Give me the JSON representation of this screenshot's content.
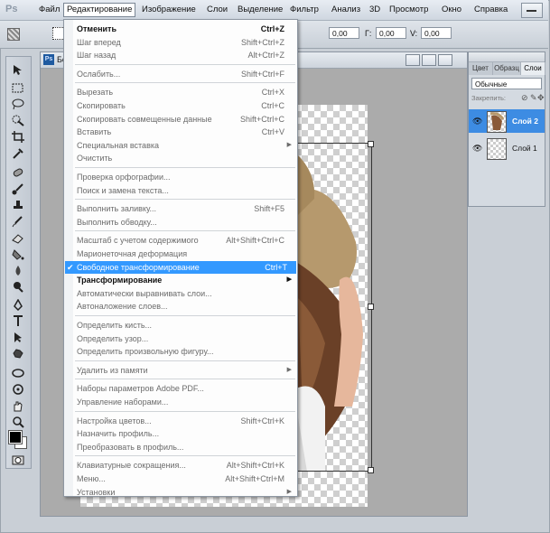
{
  "menubar": {
    "logo": "Ps",
    "items": [
      "Файл",
      "Редактирование",
      "Изображение",
      "Слои",
      "Выделение",
      "Фильтр",
      "Анализ",
      "3D",
      "Просмотр",
      "Окно",
      "Справка"
    ]
  },
  "options": {
    "f1_value": "0,00",
    "f2_label": "Г:",
    "f2_value": "0,00",
    "f3_label": "V:",
    "f3_value": "0,00"
  },
  "document": {
    "title_fragment": "Бе"
  },
  "layers_panel": {
    "tabs": [
      "Цвет",
      "Образц",
      "Слои"
    ],
    "blend_mode": "Обычные",
    "lock_label": "Закрепить:",
    "layers": [
      {
        "name": "Слой 2",
        "selected": true
      },
      {
        "name": "Слой 1",
        "selected": false
      }
    ]
  },
  "edit_menu": [
    {
      "label": "Отменить",
      "shortcut": "Ctrl+Z",
      "state": "bold"
    },
    {
      "label": "Шаг вперед",
      "shortcut": "Shift+Ctrl+Z",
      "state": "disabled"
    },
    {
      "label": "Шаг назад",
      "shortcut": "Alt+Ctrl+Z",
      "state": "disabled"
    },
    {
      "sep": true
    },
    {
      "label": "Ослабить...",
      "shortcut": "Shift+Ctrl+F",
      "state": "disabled"
    },
    {
      "sep": true
    },
    {
      "label": "Вырезать",
      "shortcut": "Ctrl+X",
      "state": "disabled"
    },
    {
      "label": "Скопировать",
      "shortcut": "Ctrl+C",
      "state": "disabled"
    },
    {
      "label": "Скопировать совмещенные данные",
      "shortcut": "Shift+Ctrl+C",
      "state": "disabled"
    },
    {
      "label": "Вставить",
      "shortcut": "Ctrl+V",
      "state": "disabled"
    },
    {
      "label": "Специальная вставка",
      "shortcut": "",
      "state": "disabled",
      "submenu": true
    },
    {
      "label": "Очистить",
      "shortcut": "",
      "state": "disabled"
    },
    {
      "sep": true
    },
    {
      "label": "Проверка орфографии...",
      "shortcut": "",
      "state": "disabled"
    },
    {
      "label": "Поиск и замена текста...",
      "shortcut": "",
      "state": "disabled"
    },
    {
      "sep": true
    },
    {
      "label": "Выполнить заливку...",
      "shortcut": "Shift+F5",
      "state": "disabled"
    },
    {
      "label": "Выполнить обводку...",
      "shortcut": "",
      "state": "disabled"
    },
    {
      "sep": true
    },
    {
      "label": "Масштаб с учетом содержимого",
      "shortcut": "Alt+Shift+Ctrl+C",
      "state": "disabled"
    },
    {
      "label": "Марионеточная деформация",
      "shortcut": "",
      "state": "disabled"
    },
    {
      "label": "Свободное трансформирование",
      "shortcut": "Ctrl+T",
      "state": "highlight",
      "check": "✔"
    },
    {
      "label": "Трансформирование",
      "shortcut": "",
      "state": "bold",
      "submenu": true
    },
    {
      "label": "Автоматически выравнивать слои...",
      "shortcut": "",
      "state": "disabled"
    },
    {
      "label": "Автоналожение слоев...",
      "shortcut": "",
      "state": "disabled"
    },
    {
      "sep": true
    },
    {
      "label": "Определить кисть...",
      "shortcut": "",
      "state": "disabled"
    },
    {
      "label": "Определить узор...",
      "shortcut": "",
      "state": "disabled"
    },
    {
      "label": "Определить произвольную фигуру...",
      "shortcut": "",
      "state": "disabled"
    },
    {
      "sep": true
    },
    {
      "label": "Удалить из памяти",
      "shortcut": "",
      "state": "disabled",
      "submenu": true
    },
    {
      "sep": true
    },
    {
      "label": "Наборы параметров Adobe PDF...",
      "shortcut": "",
      "state": "disabled"
    },
    {
      "label": "Управление наборами...",
      "shortcut": "",
      "state": "disabled"
    },
    {
      "sep": true
    },
    {
      "label": "Настройка цветов...",
      "shortcut": "Shift+Ctrl+K",
      "state": "disabled"
    },
    {
      "label": "Назначить профиль...",
      "shortcut": "",
      "state": "disabled"
    },
    {
      "label": "Преобразовать в профиль...",
      "shortcut": "",
      "state": "disabled"
    },
    {
      "sep": true
    },
    {
      "label": "Клавиатурные сокращения...",
      "shortcut": "Alt+Shift+Ctrl+K",
      "state": "disabled"
    },
    {
      "label": "Меню...",
      "shortcut": "Alt+Shift+Ctrl+M",
      "state": "disabled"
    },
    {
      "label": "Установки",
      "shortcut": "",
      "state": "disabled",
      "submenu": true
    }
  ],
  "colors": {
    "highlight": "#3399ff",
    "selected_layer": "#3d8ce3"
  }
}
